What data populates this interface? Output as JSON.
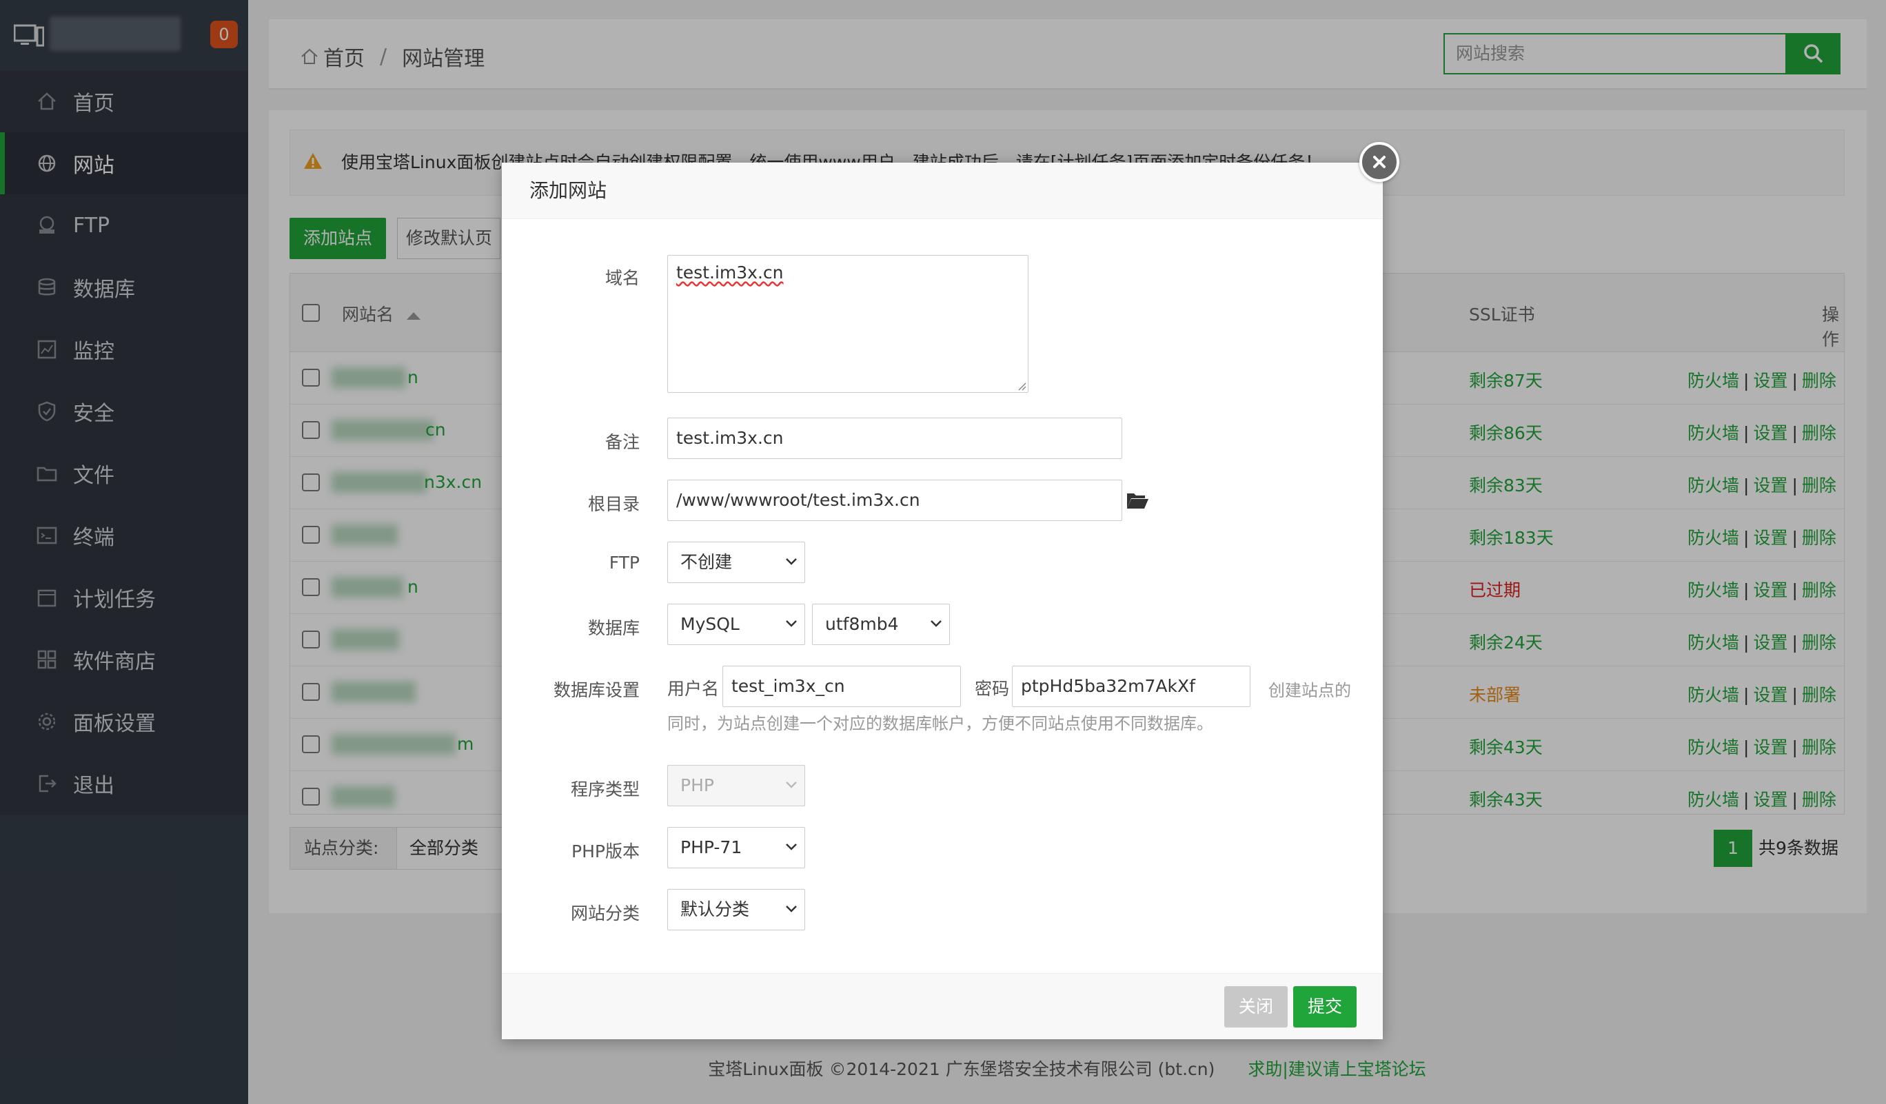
{
  "sidebar": {
    "badge": "0",
    "items": [
      {
        "label": "首页"
      },
      {
        "label": "网站"
      },
      {
        "label": "FTP"
      },
      {
        "label": "数据库"
      },
      {
        "label": "监控"
      },
      {
        "label": "安全"
      },
      {
        "label": "文件"
      },
      {
        "label": "终端"
      },
      {
        "label": "计划任务"
      },
      {
        "label": "软件商店"
      },
      {
        "label": "面板设置"
      },
      {
        "label": "退出"
      }
    ]
  },
  "header": {
    "breadcrumb_home": "首页",
    "breadcrumb_sep": "/",
    "breadcrumb_current": "网站管理",
    "search_placeholder": "网站搜索"
  },
  "main": {
    "notice": "使用宝塔Linux面板创建站点时会自动创建权限配置，统一使用www用户。建站成功后，请在[计划任务]页面添加定时备份任务！",
    "add_site": "添加站点",
    "modify_default": "修改默认页",
    "columns": {
      "name": "网站名",
      "ssl": "SSL证书",
      "ops": "操作"
    },
    "rows": [
      {
        "tail": "n",
        "ssl": "剩余87天"
      },
      {
        "tail": "cn",
        "ssl": "剩余86天"
      },
      {
        "tail": "n3x.cn",
        "ssl": "剩余83天"
      },
      {
        "tail": "",
        "ssl": "剩余183天"
      },
      {
        "tail": "n",
        "ssl": "已过期"
      },
      {
        "tail": "",
        "ssl": "剩余24天"
      },
      {
        "tail": "",
        "ssl": "未部署"
      },
      {
        "tail": "m",
        "ssl": "剩余43天"
      },
      {
        "tail": "",
        "ssl": "剩余43天"
      }
    ],
    "op_firewall": "防火墙",
    "op_settings": "设置",
    "op_delete": "删除",
    "op_sep": "|",
    "category_label": "站点分类:",
    "category_value": "全部分类",
    "page_current": "1",
    "page_total": "共9条数据"
  },
  "colors": {
    "green": "#20a53a",
    "expired": "#e02020",
    "undeployed": "#e88a1a"
  },
  "footer": {
    "copyright": "宝塔Linux面板 ©2014-2021 广东堡塔安全技术有限公司 (bt.cn)",
    "forum": "求助|建议请上宝塔论坛"
  },
  "modal": {
    "title": "添加网站",
    "domain_label": "域名",
    "domain_value": "test.im3x.cn",
    "remark_label": "备注",
    "remark_value": "test.im3x.cn",
    "root_label": "根目录",
    "root_value": "/www/wwwroot/test.im3x.cn",
    "ftp_label": "FTP",
    "ftp_value": "不创建",
    "db_label": "数据库",
    "db_value": "MySQL",
    "charset_value": "utf8mb4",
    "dbset_label": "数据库设置",
    "user_label": "用户名",
    "user_value": "test_im3x_cn",
    "pwd_label": "密码",
    "pwd_value": "ptpHd5ba32m7AkXf",
    "hint_1": "创建站点的",
    "hint_2": "同时，为站点创建一个对应的数据库帐户，方便不同站点使用不同数据库。",
    "type_label": "程序类型",
    "type_value": "PHP",
    "php_label": "PHP版本",
    "php_value": "PHP-71",
    "cat_label": "网站分类",
    "cat_value": "默认分类",
    "close_btn": "关闭",
    "submit_btn": "提交"
  }
}
